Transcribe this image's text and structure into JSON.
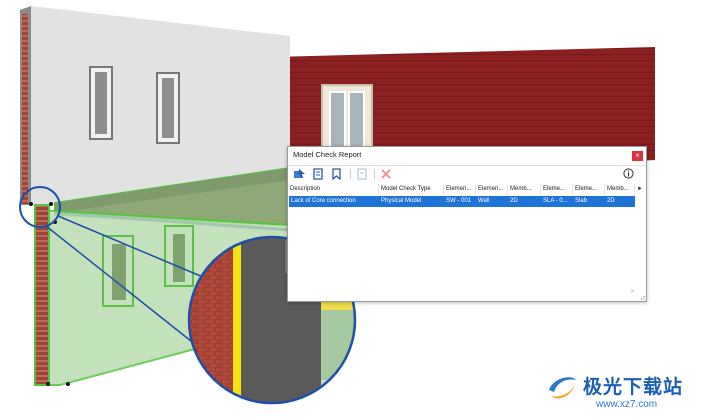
{
  "dialog": {
    "title": "Model Check Report",
    "close_icon": "close-icon",
    "toolbar": {
      "buttons": [
        "select-elements-icon",
        "open-report-icon",
        "mark-icon",
        "export-icon",
        "delete-icon"
      ],
      "info_icon": "info-icon"
    },
    "columns": [
      "Description",
      "Model Check Type",
      "Elemen...",
      "Elemen...",
      "Memb...",
      "Eleme...",
      "Eleme...",
      "Memb..."
    ],
    "rows": [
      [
        "Lack of Core connection",
        "Physical Model",
        "SW - 001",
        "Wall",
        "2D",
        "SLA - 0...",
        "Slab",
        "2D"
      ]
    ],
    "selected_row_color": "#1e73d6"
  },
  "watermark": {
    "brand": "极光下载站",
    "url": "www.xz7.com"
  },
  "colors": {
    "wall_green": "#6ab85a",
    "brick_red": "#8a1f1f",
    "highlight_blue": "#1e4fa8",
    "core_yellow": "#f5e312"
  }
}
